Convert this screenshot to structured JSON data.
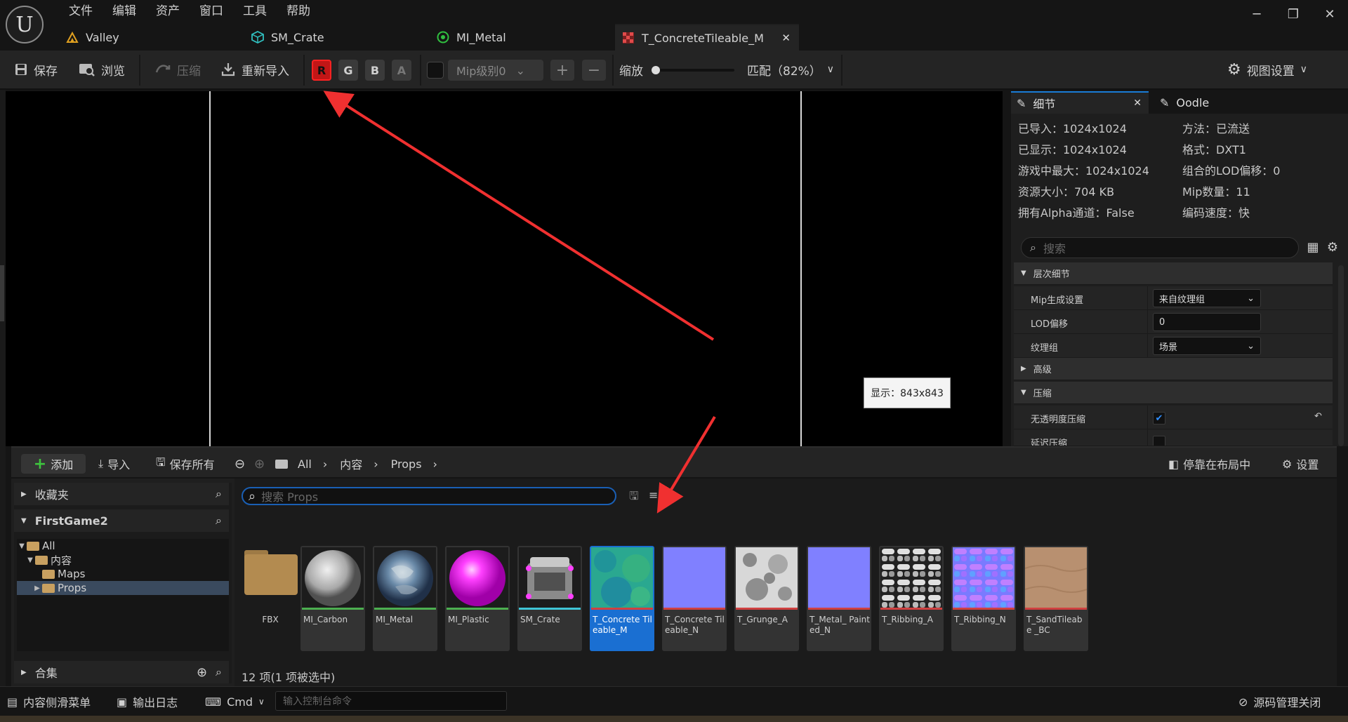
{
  "logo": "U",
  "menu": [
    "文件",
    "编辑",
    "资产",
    "窗口",
    "工具",
    "帮助"
  ],
  "window_controls": [
    "─",
    "❐",
    "✕"
  ],
  "tabs": [
    {
      "label": "Valley",
      "icon": "level-icon",
      "color": "#e0a020"
    },
    {
      "label": "SM_Crate",
      "icon": "static-mesh-icon",
      "color": "#30c0c0"
    },
    {
      "label": "MI_Metal",
      "icon": "material-instance-icon",
      "color": "#30c040"
    },
    {
      "label": "T_ConcreteTileable_M",
      "icon": "texture-icon",
      "color": "#d04040",
      "close": "✕"
    }
  ],
  "toolbar": {
    "save": "保存",
    "browse": "浏览",
    "compress": "压缩",
    "reimport": "重新导入",
    "channels": [
      "R",
      "G",
      "B",
      "A"
    ],
    "mip": "Mip级别0",
    "zoom_label": "缩放",
    "zoom_fit": "匹配（82%）",
    "view_settings": "视图设置"
  },
  "viewport": {
    "display_size": "显示：843x843"
  },
  "details": {
    "tab_details": "细节",
    "tab_oodle": "Oodle",
    "tab_close": "✕",
    "info_left": [
      "已导入：1024x1024",
      "已显示：1024x1024",
      "游戏中最大：1024x1024",
      "资源大小：704 KB",
      "拥有Alpha通道：False"
    ],
    "info_right": [
      "方法：已流送",
      "格式：DXT1",
      "组合的LOD偏移：0",
      "Mip数量：11",
      "编码速度：快"
    ],
    "search_placeholder": "搜索",
    "cat_level_detail": "层次细节",
    "mip_gen_label": "Mip生成设置",
    "mip_gen_value": "来自纹理组",
    "lod_bias_label": "LOD偏移",
    "lod_bias_value": "0",
    "texture_group_label": "纹理组",
    "texture_group_value": "场景",
    "cat_advanced": "高级",
    "cat_compression": "压缩",
    "no_alpha_label": "无透明度压缩",
    "defer_label": "延迟压缩"
  },
  "drawer": {
    "add": "添加",
    "import": "导入",
    "save_all": "保存所有",
    "crumbs": [
      "All",
      "内容",
      "Props"
    ],
    "dock": "停靠在布局中",
    "settings": "设置",
    "favorites": "收藏夹",
    "project": "FirstGame2",
    "tree": [
      "All",
      "内容",
      "Maps",
      "Props"
    ],
    "collections": "合集",
    "search_placeholder": "搜索 Props",
    "fbx_label": "FBX",
    "assets": [
      {
        "name": "MI_Carbon",
        "strip": "#4caf50",
        "thumb": "sphere-gray"
      },
      {
        "name": "MI_Metal",
        "strip": "#4caf50",
        "thumb": "sphere-earth"
      },
      {
        "name": "MI_Plastic",
        "strip": "#4caf50",
        "thumb": "sphere-magenta"
      },
      {
        "name": "SM_Crate",
        "strip": "#3fc6d6",
        "thumb": "crate"
      },
      {
        "name": "T_Concrete Tileable_M",
        "strip": "#d04040",
        "thumb": "teal-noise"
      },
      {
        "name": "T_Concrete Tileable_N",
        "strip": "#d04040",
        "thumb": "normal-flat"
      },
      {
        "name": "T_Grunge_A",
        "strip": "#d04040",
        "thumb": "grunge"
      },
      {
        "name": "T_Metal_ Painted_N",
        "strip": "#d04040",
        "thumb": "normal-flat"
      },
      {
        "name": "T_Ribbing_A",
        "strip": "#d04040",
        "thumb": "ribbing"
      },
      {
        "name": "T_Ribbing_N",
        "strip": "#d04040",
        "thumb": "ribbing-normal"
      },
      {
        "name": "T_SandTileabe _BC",
        "strip": "#d04040",
        "thumb": "sand"
      }
    ],
    "count": "12 项(1 项被选中)"
  },
  "statusbar": {
    "content_drawer": "内容侧滑菜单",
    "output_log": "输出日志",
    "cmd": "Cmd",
    "cmd_placeholder": "输入控制台命令",
    "source_control": "源码管理关闭"
  }
}
